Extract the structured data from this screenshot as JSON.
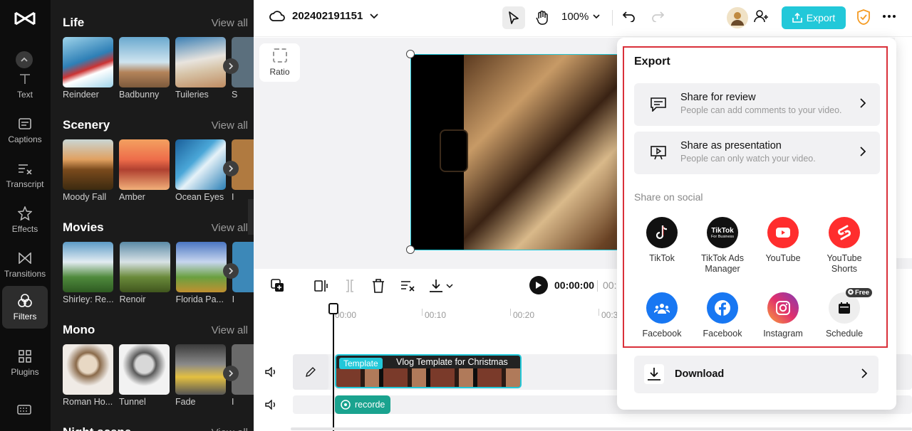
{
  "rail": {
    "items": [
      {
        "label": "Text",
        "icon": "text-icon"
      },
      {
        "label": "Captions",
        "icon": "captions-icon"
      },
      {
        "label": "Transcript",
        "icon": "transcript-icon"
      },
      {
        "label": "Effects",
        "icon": "effects-icon"
      },
      {
        "label": "Transitions",
        "icon": "transitions-icon"
      },
      {
        "label": "Filters",
        "icon": "filters-icon"
      },
      {
        "label": "Plugins",
        "icon": "plugins-icon"
      }
    ],
    "active": "Filters"
  },
  "filters": {
    "view_all": "View all",
    "sections": [
      {
        "title": "Life",
        "items": [
          "Reindeer",
          "Badbunny",
          "Tuileries",
          "S"
        ]
      },
      {
        "title": "Scenery",
        "items": [
          "Moody Fall",
          "Amber",
          "Ocean Eyes",
          "I"
        ]
      },
      {
        "title": "Movies",
        "items": [
          "Shirley: Re...",
          "Renoir",
          "Florida Pa...",
          "I"
        ]
      },
      {
        "title": "Mono",
        "items": [
          "Roman Ho...",
          "Tunnel",
          "Fade",
          "I"
        ]
      },
      {
        "title": "Night scene",
        "items": []
      }
    ]
  },
  "header": {
    "project_name": "202402191151",
    "zoom": "100%",
    "export_label": "Export"
  },
  "canvas": {
    "ratio_label": "Ratio"
  },
  "timeline": {
    "current_time": "00:00:00",
    "total_time_partial": "00:",
    "ruler": [
      "00:00",
      "00:10",
      "00:20",
      "00:3"
    ],
    "clip_badge": "Template",
    "clip_name": "Vlog Template for Christmas",
    "audio_clip": "recorde"
  },
  "export_popup": {
    "title": "Export",
    "share_review": {
      "title": "Share for review",
      "subtitle": "People can add comments to your video."
    },
    "share_presentation": {
      "title": "Share as presentation",
      "subtitle": "People can only watch your video."
    },
    "social_heading": "Share on social",
    "social": [
      {
        "label": "TikTok",
        "color": "#111111",
        "icon": "tiktok-icon"
      },
      {
        "label": "TikTok Ads Manager",
        "color": "#111111",
        "icon": "tiktok-business-icon",
        "icon_text": "TikTok",
        "icon_sub": "For Business"
      },
      {
        "label": "YouTube",
        "color": "#ff2d2d",
        "icon": "youtube-icon"
      },
      {
        "label": "YouTube Shorts",
        "color": "#ff2d2d",
        "icon": "youtube-shorts-icon"
      },
      {
        "label": "Facebook",
        "color": "#1877f2",
        "icon": "facebook-group-icon"
      },
      {
        "label": "Facebook",
        "color": "#1877f2",
        "icon": "facebook-icon"
      },
      {
        "label": "Instagram",
        "color": "#d62976",
        "icon": "instagram-icon"
      },
      {
        "label": "Schedule",
        "color": "#eeeeee",
        "icon": "calendar-icon",
        "badge": "Free"
      }
    ],
    "download_label": "Download"
  },
  "colors": {
    "accent": "#22c8d9",
    "highlight_box": "#d9303a",
    "shield": "#f59b22"
  }
}
